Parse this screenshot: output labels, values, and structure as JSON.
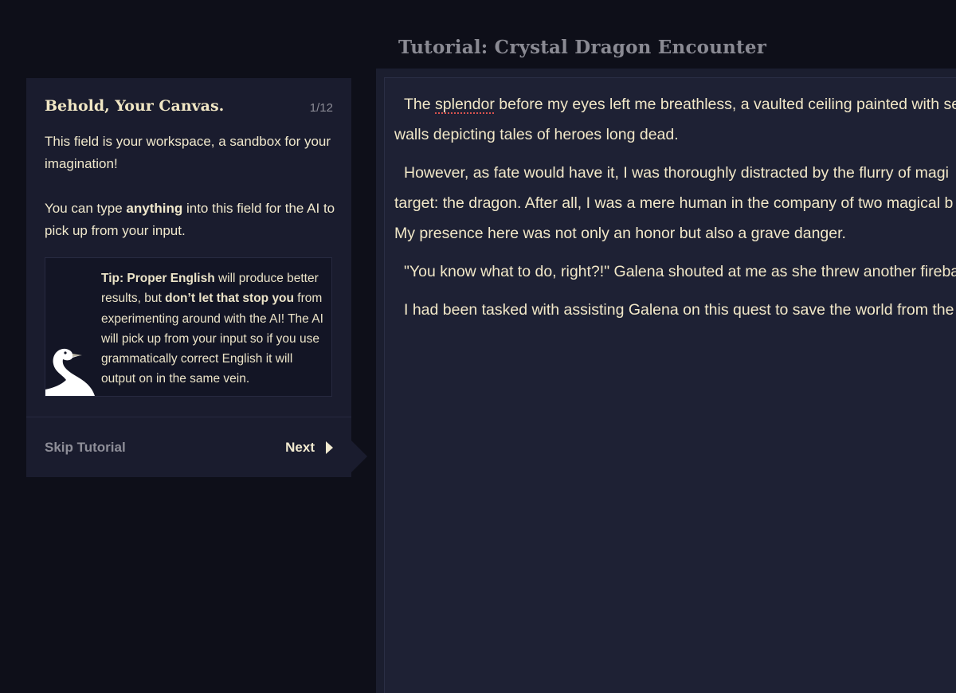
{
  "story": {
    "title": "Tutorial: Crystal Dragon Encounter",
    "paragraphs": [
      {
        "line1_before": "The ",
        "line1_misspelled": "splendor",
        "line1_after": " before my eyes left me breathless, a vaulted ceiling painted with se",
        "line2": "walls depicting tales of heroes long dead."
      },
      {
        "line1": "However, as fate would have it, I was thoroughly distracted by the flurry of magi",
        "line2": "target: the dragon. After all, I was a mere human in the company of two magical b",
        "line3": "My presence here was not only an honor but also a grave danger."
      },
      {
        "line1": "\"You know what to do, right?!\" Galena shouted at me as she threw another fireba"
      },
      {
        "line1": "I had been tasked with assisting Galena on this quest to save the world from the"
      }
    ]
  },
  "tutorial": {
    "title": "Behold, Your Canvas.",
    "step": "1/12",
    "body1": "This field is your workspace, a sandbox for your imagination!",
    "body2_before": "You can type ",
    "body2_bold": "anything",
    "body2_after": " into this field for the AI to pick up from your input.",
    "tip_bold1": "Tip: Proper English",
    "tip_text1": " will produce better results, but ",
    "tip_bold2": "don’t let that stop you",
    "tip_text2": " from experimenting around with the AI! The AI will pick up from your input so if you use grammatically correct English it will output on in the same vein.",
    "tip_icon": "goose-mascot-icon",
    "skip_label": "Skip Tutorial",
    "next_label": "Next",
    "next_icon": "play-triangle-icon"
  },
  "colors": {
    "background": "#0e0f19",
    "panel": "#1a1c2e",
    "editor": "#1e2134",
    "text_cream": "#f2e8c8",
    "muted": "#8c8c96",
    "spellcheck": "#d9534f"
  }
}
